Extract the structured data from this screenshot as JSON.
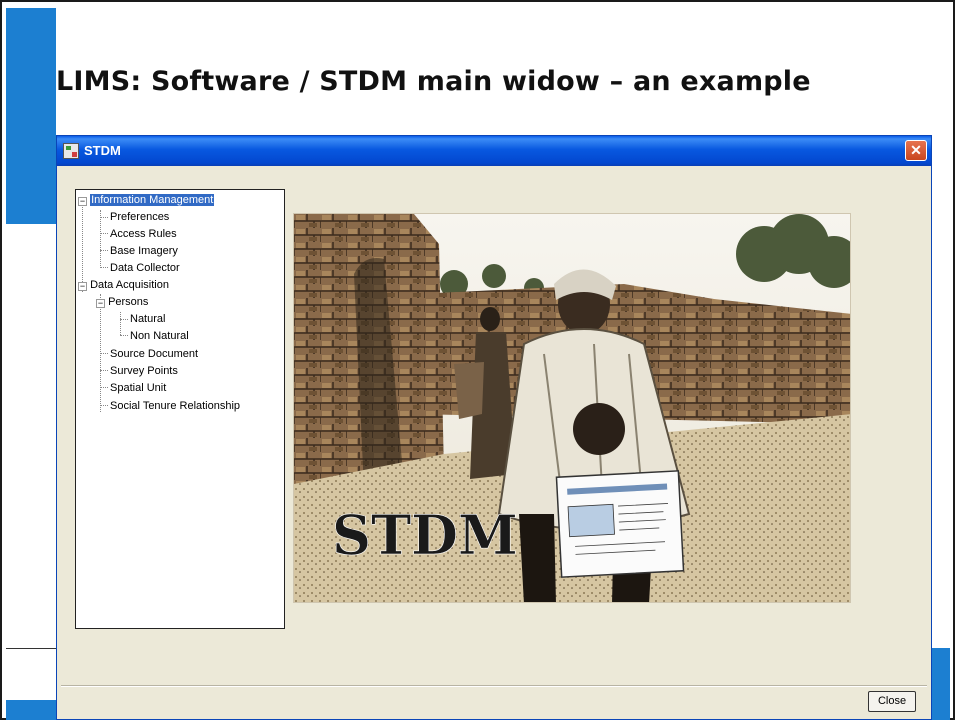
{
  "slide": {
    "title": "LIMS: Software / STDM main widow – an example"
  },
  "window": {
    "title": "STDM",
    "close_glyph": "✕",
    "close_button_label": "Close"
  },
  "tree": {
    "items": [
      {
        "label": "Information Management",
        "expanded": true
      },
      {
        "label": "Preferences"
      },
      {
        "label": "Access Rules"
      },
      {
        "label": "Base Imagery"
      },
      {
        "label": "Data Collector"
      },
      {
        "label": "Data Acquisition",
        "expanded": true
      },
      {
        "label": "Persons",
        "expanded": true
      },
      {
        "label": "Natural"
      },
      {
        "label": "Non Natural"
      },
      {
        "label": "Source Document"
      },
      {
        "label": "Survey Points"
      },
      {
        "label": "Spatial Unit"
      },
      {
        "label": "Social Tenure Relationship"
      }
    ],
    "expander_glyph": "−"
  },
  "photo": {
    "overlay_text": "STDM"
  },
  "colors": {
    "accent": "#1c7fd1",
    "titlebar": "#0858e0",
    "selection": "#316ac5"
  }
}
